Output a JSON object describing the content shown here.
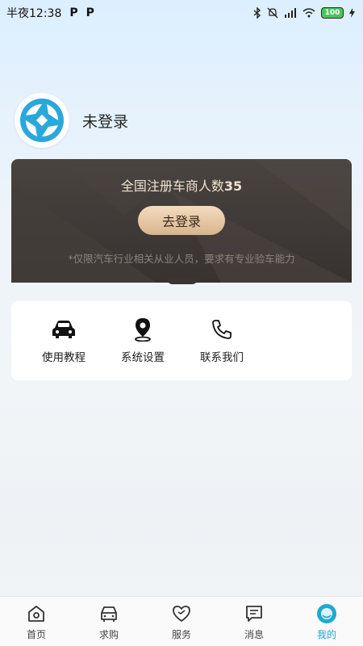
{
  "status_bar": {
    "time": "半夜12:38",
    "app_icons": [
      "P",
      "P"
    ],
    "battery": "100"
  },
  "profile": {
    "username": "未登录"
  },
  "banner": {
    "title_prefix": "全国注册车商人数",
    "title_count": "35",
    "login_label": "去登录",
    "note": "*仅限汽车行业相关从业人员，要求有专业验车能力"
  },
  "menu": {
    "items": [
      {
        "label": "使用教程",
        "icon": "car-icon"
      },
      {
        "label": "系统设置",
        "icon": "location-pin-icon"
      },
      {
        "label": "联系我们",
        "icon": "phone-icon"
      }
    ]
  },
  "tabs": [
    {
      "label": "首页",
      "icon": "home-icon"
    },
    {
      "label": "求购",
      "icon": "car-icon"
    },
    {
      "label": "服务",
      "icon": "heart-icon"
    },
    {
      "label": "消息",
      "icon": "message-icon"
    },
    {
      "label": "我的",
      "icon": "profile-icon",
      "active": true
    }
  ],
  "colors": {
    "accent": "#21a8cf",
    "banner_bg": "#3f3a37",
    "login_button": "#e6c6a1"
  }
}
